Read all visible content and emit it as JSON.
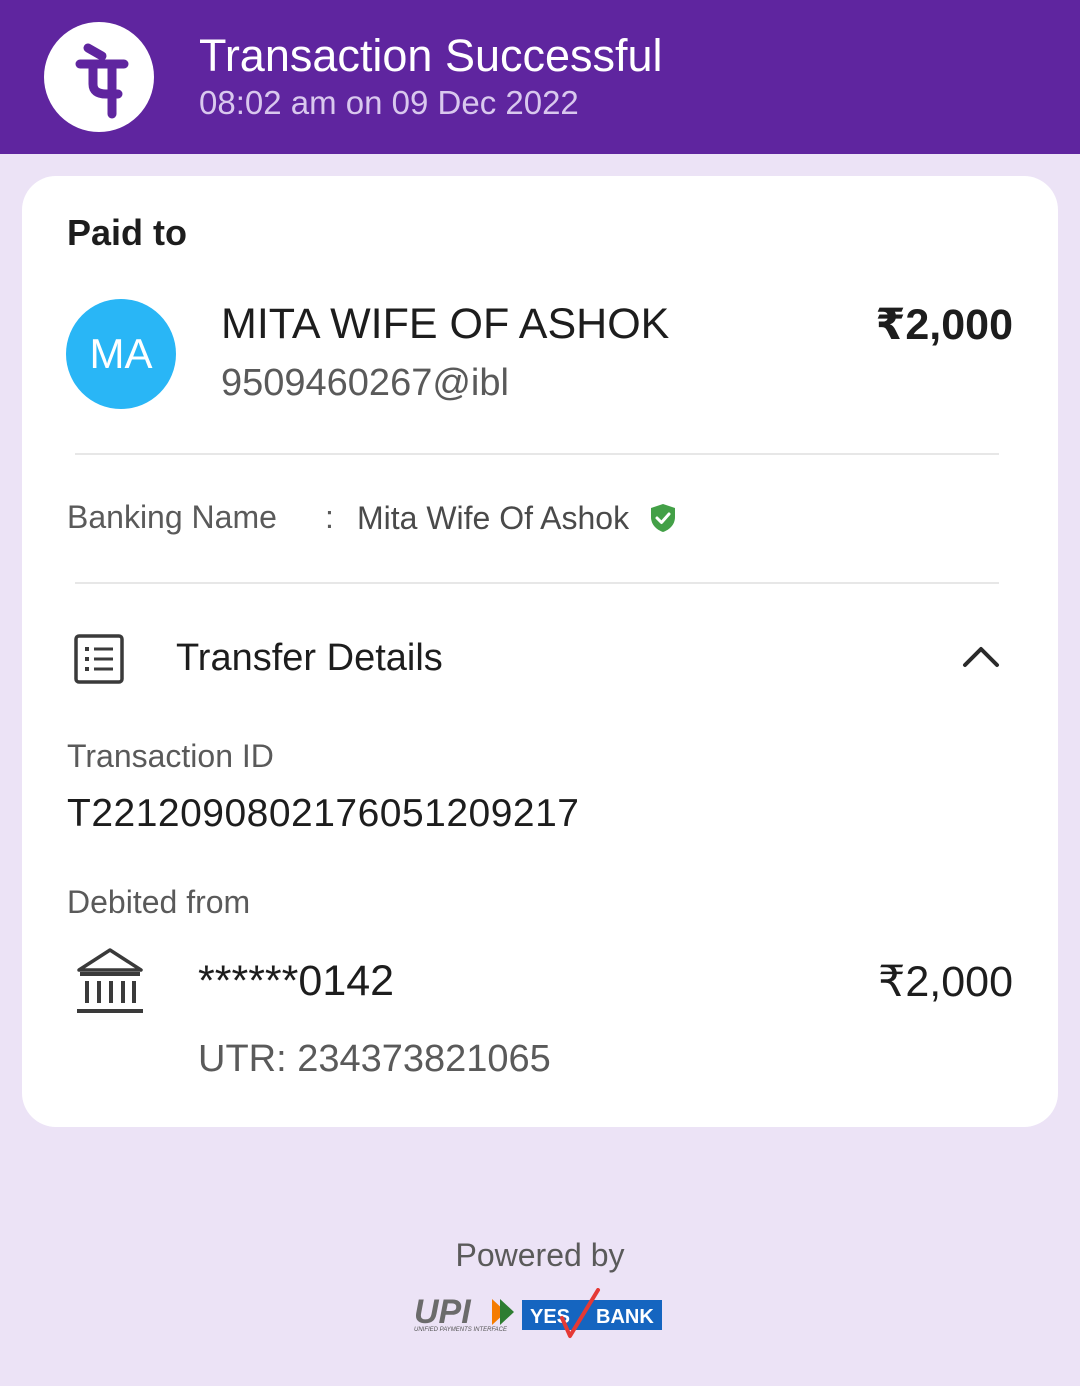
{
  "header": {
    "title": "Transaction Successful",
    "timestamp": "08:02 am on 09 Dec 2022",
    "logo_icon": "phonepe-logo-icon",
    "background_color": "#5f259f"
  },
  "payment": {
    "paid_to_label": "Paid to",
    "avatar_initials": "MA",
    "avatar_color": "#29b6f6",
    "payee_name": "MITA WIFE OF ASHOK",
    "payee_upi": "9509460267@ibl",
    "amount": "₹2,000"
  },
  "banking_name": {
    "label": "Banking Name",
    "separator": ":",
    "value": "Mita Wife Of Ashok",
    "verified_icon": "verified-shield-icon",
    "verified_color": "#43a047"
  },
  "transfer_details": {
    "title": "Transfer Details",
    "icon": "receipt-list-icon",
    "toggle_icon": "chevron-up-icon",
    "transaction_id_label": "Transaction ID",
    "transaction_id": "T2212090802176051209217",
    "debited_from_label": "Debited from",
    "bank_icon": "bank-icon",
    "account_masked": "******0142",
    "debited_amount": "₹2,000",
    "utr": "UTR: 234373821065"
  },
  "footer": {
    "powered_by": "Powered by",
    "upi_logo_text": "UPI",
    "upi_tagline": "UNIFIED PAYMENTS INTERFACE",
    "bank_logo_yes": "YES",
    "bank_logo_bank": "BANK"
  }
}
